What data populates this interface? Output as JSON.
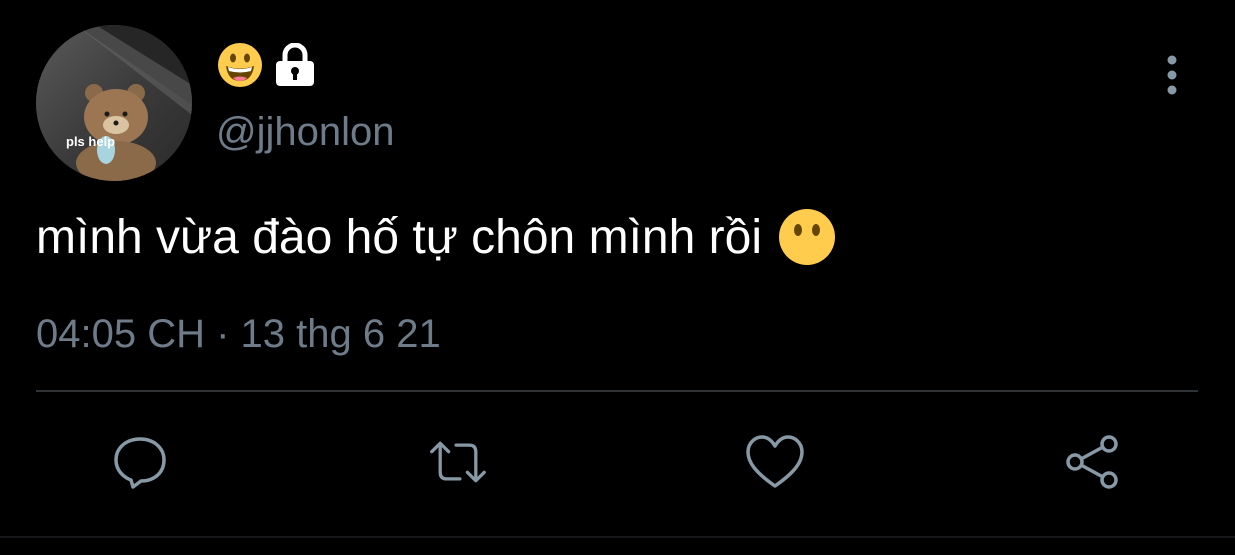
{
  "tweet": {
    "avatar_caption": "pls help",
    "display_name_icons": [
      "grinning-face-emoji",
      "lock-icon"
    ],
    "handle": "@jjhonlon",
    "content_text": "mình vừa đào hố tự chôn mình rồi",
    "content_emoji": "face-without-mouth-emoji",
    "timestamp": "04:05 CH · 13 thg 6 21"
  },
  "actions": [
    "reply-icon",
    "retweet-icon",
    "like-icon",
    "share-icon"
  ],
  "colors": {
    "background": "#000000",
    "text_primary": "#ffffff",
    "text_secondary": "#6e7b89",
    "icon": "#8899a6",
    "divider": "#2f3336",
    "emoji_yellow": "#ffcc4d"
  }
}
